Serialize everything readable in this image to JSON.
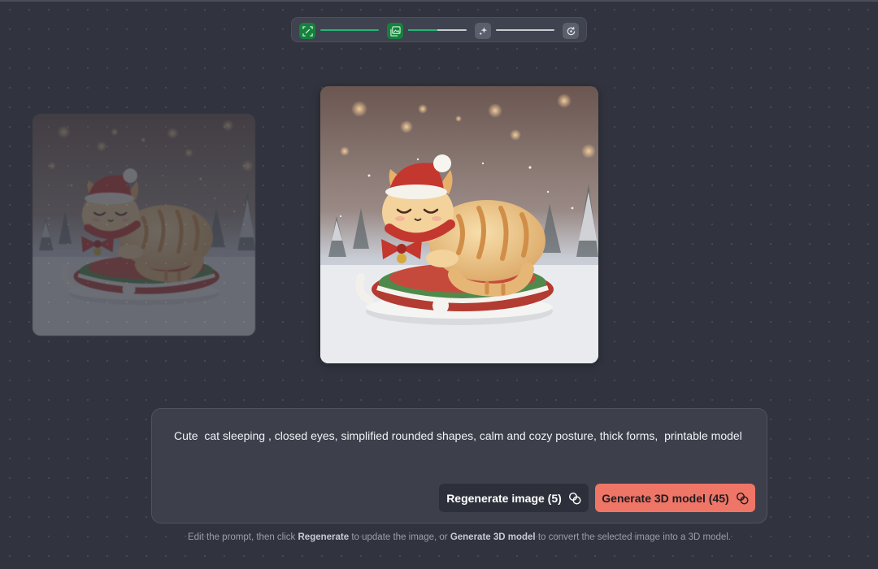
{
  "stepper": {
    "steps": [
      {
        "icon": "scan-icon",
        "state": "complete",
        "progress": 1.0
      },
      {
        "icon": "image-stack-icon",
        "state": "active",
        "progress": 0.5
      },
      {
        "icon": "sparkle-icon",
        "state": "pending",
        "progress": 0.0
      },
      {
        "icon": "rotate-3d-icon",
        "state": "pending"
      }
    ],
    "active_color": "#16813d",
    "progress_color": "#22b573"
  },
  "images": [
    {
      "state": "unselected",
      "subject": "sleeping cat figurine"
    },
    {
      "state": "selected",
      "subject": "sleeping cat figurine"
    }
  ],
  "prompt": {
    "text": "Cute  cat sleeping , closed eyes, simplified rounded shapes, calm and cozy posture, thick forms,  printable model"
  },
  "buttons": {
    "regenerate_label": "Regenerate image (5)",
    "generate_label": "Generate 3D model (45)",
    "accent_color": "#ef7566"
  },
  "hint": {
    "part1": "Edit the prompt, then click ",
    "regenerate": "Regenerate",
    "part2": " to update the image, or ",
    "generate": "Generate 3D model",
    "part3": " to convert the selected image into a 3D model."
  }
}
